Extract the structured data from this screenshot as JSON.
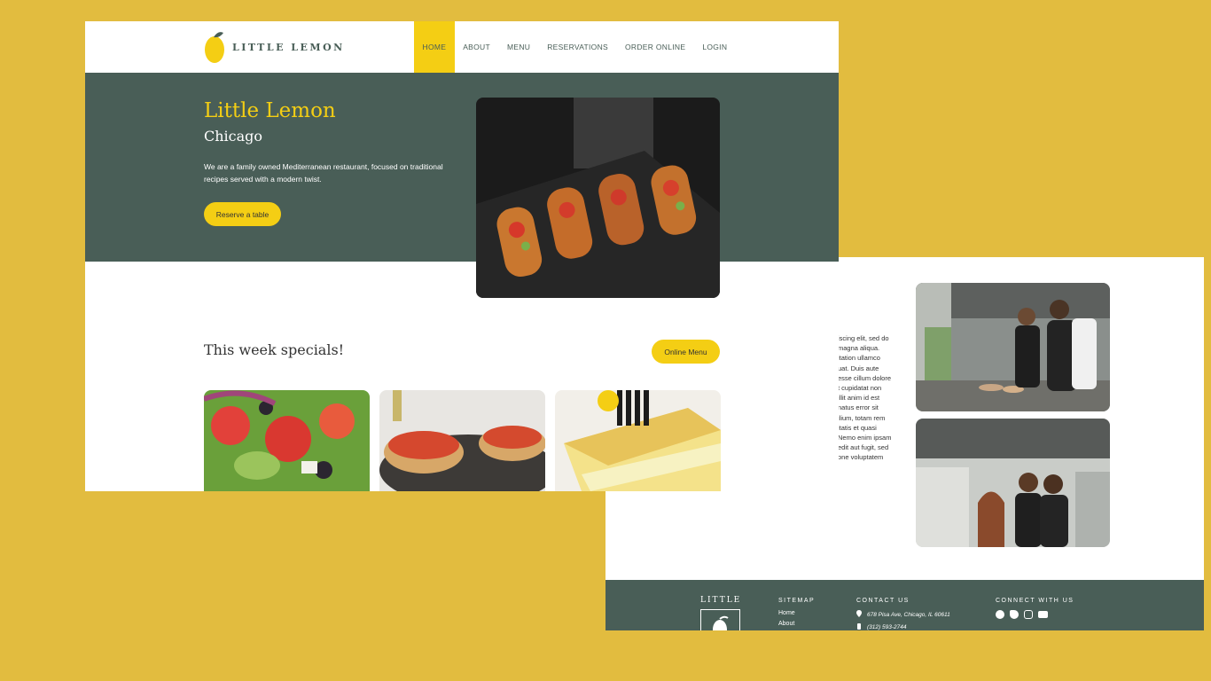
{
  "colors": {
    "background": "#E2BC3F",
    "primary_green": "#495E57",
    "primary_yellow": "#F4CE14",
    "white": "#FFFFFF"
  },
  "nav": {
    "brand": "LITTLE LEMON",
    "items": [
      {
        "label": "HOME",
        "active": true
      },
      {
        "label": "ABOUT",
        "active": false
      },
      {
        "label": "MENU",
        "active": false
      },
      {
        "label": "RESERVATIONS",
        "active": false
      },
      {
        "label": "ORDER ONLINE",
        "active": false
      },
      {
        "label": "LOGIN",
        "active": false
      }
    ]
  },
  "hero": {
    "title": "Little Lemon",
    "subtitle": "Chicago",
    "description": "We are a family owned Mediterranean restaurant, focused on traditional recipes served with a modern twist.",
    "cta": "Reserve a table"
  },
  "specials": {
    "title": "This week specials!",
    "cta": "Online Menu"
  },
  "about": {
    "lines": [
      "iscing elit, sed do",
      "magna aliqua.",
      "itation ullamco",
      "uat. Duis aute",
      "esse cillum dolore",
      "t cupidatat non",
      "illit anim id est",
      "natus error sit",
      "ilium, totam rem",
      "itatis et quasi",
      "Nemo enim ipsam",
      "edit aut fugit, sed",
      "one voluptatem"
    ]
  },
  "footer": {
    "logo_text": "LITTLE",
    "sitemap_heading": "SITEMAP",
    "sitemap_links": [
      "Home",
      "About"
    ],
    "contact_heading": "CONTACT US",
    "address": "678 Pisa Ave, Chicago, IL 60611",
    "phone": "(312) 593-2744",
    "social_heading": "CONNECT WITH US",
    "social_icons": [
      "facebook-icon",
      "twitter-icon",
      "instagram-icon",
      "youtube-icon"
    ]
  }
}
